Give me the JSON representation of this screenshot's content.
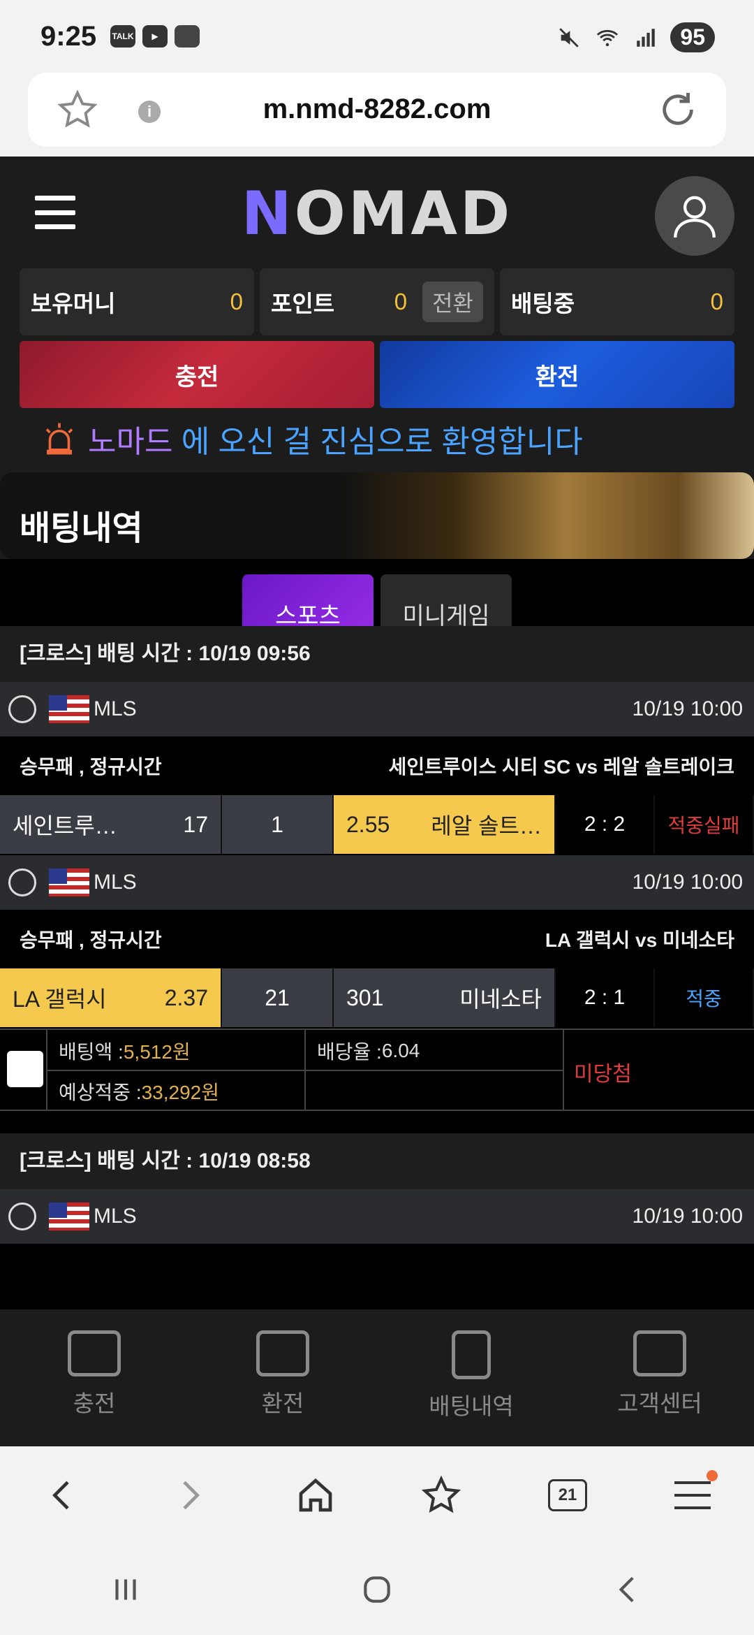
{
  "status_bar": {
    "time": "9:25",
    "battery": "95",
    "notif_talk": "TALK"
  },
  "url_bar": {
    "url": "m.nmd-8282.com"
  },
  "header": {
    "logo": "OMAD",
    "logo_mark": "N"
  },
  "balances": {
    "money_label": "보유머니",
    "money_value": "0",
    "point_label": "포인트",
    "point_value": "0",
    "convert_label": "전환",
    "betting_label": "배팅중",
    "betting_value": "0"
  },
  "actions": {
    "charge": "충전",
    "exchange": "환전"
  },
  "notice": {
    "brand": "노마드",
    "text": "에 오신 걸 진심으로 환영합니다"
  },
  "banner": {
    "title": "배팅내역"
  },
  "tabs": {
    "sports": "스포츠",
    "minigame": "미니게임"
  },
  "bets": [
    {
      "header": "[크로스] 배팅 시간 : 10/19 09:56",
      "games": [
        {
          "league": "MLS",
          "date": "10/19 10:00",
          "market": "승무패 , 정규시간",
          "teams": "세인트루이스 시티 SC  vs  레알 솔트레이크",
          "home": "세인트루…",
          "home_odds": "17",
          "draw": "1",
          "away_odds": "2.55",
          "away": "레알 솔트…",
          "score": "2 : 2",
          "result": "적중실패"
        },
        {
          "league": "MLS",
          "date": "10/19 10:00",
          "market": "승무패 , 정규시간",
          "teams": "LA 갤럭시  vs  미네소타",
          "home": "LA 갤럭시",
          "home_odds": "2.37",
          "draw": "21",
          "away_odds": "301",
          "away": "미네소타",
          "score": "2 : 1",
          "result": "적중"
        }
      ],
      "summary": {
        "bet_amount_label": "배팅액 : ",
        "bet_amount": "5,512원",
        "rate_label": "배당율 : ",
        "rate": "6.04",
        "expected_label": "예상적중 : ",
        "expected": "33,292원",
        "status": "미당첨"
      }
    },
    {
      "header": "[크로스] 배팅 시간 : 10/19 08:58",
      "games": [
        {
          "league": "MLS",
          "date": "10/19 10:00"
        }
      ]
    }
  ],
  "bottom_nav": {
    "charge": "충전",
    "exchange": "환전",
    "history": "배팅내역",
    "support": "고객센터"
  },
  "browser_nav": {
    "tabs_count": "21"
  },
  "colors": {
    "accent_gold": "#f5c94e",
    "accent_purple": "#8a24dd",
    "fail_red": "#e23b3b",
    "hit_blue": "#4aa3ff"
  }
}
